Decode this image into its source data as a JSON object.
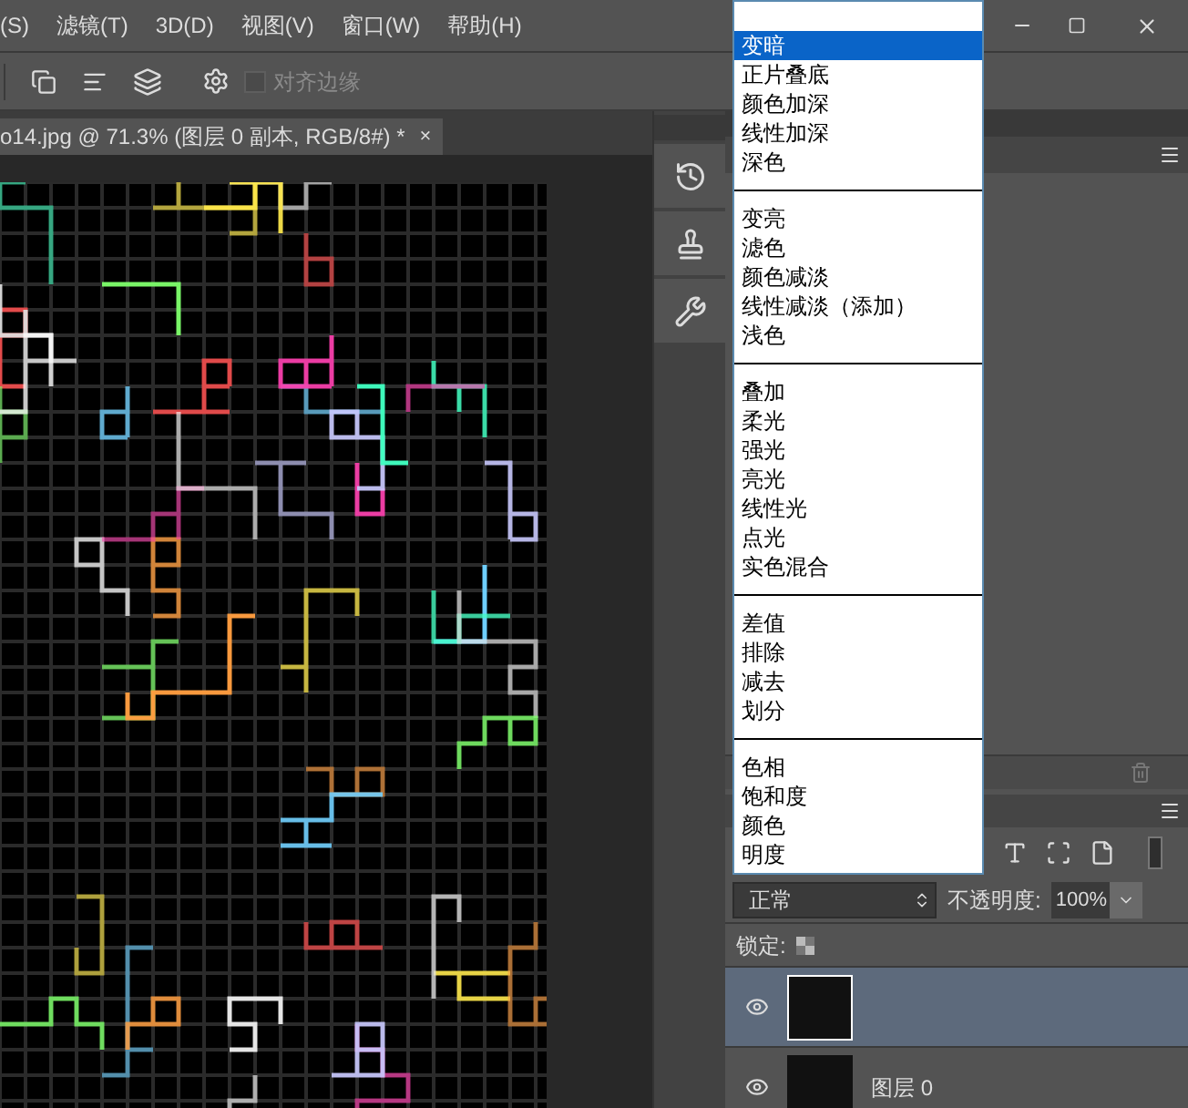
{
  "menu": [
    "(S)",
    "滤镜(T)",
    "3D(D)",
    "视图(V)",
    "窗口(W)",
    "帮助(H)"
  ],
  "options_bar": {
    "align_edges": {
      "label": "对齐边缘",
      "checked": false,
      "disabled": true
    }
  },
  "document_tab": {
    "title": "o14.jpg @ 71.3% (图层 0 副本, RGB/8#) *",
    "close": "×"
  },
  "blend_menu": {
    "groups": [
      [
        {
          "label": "变暗",
          "selected": true
        },
        {
          "label": "正片叠底",
          "selected": false
        },
        {
          "label": "颜色加深",
          "selected": false
        },
        {
          "label": "线性加深",
          "selected": false
        },
        {
          "label": "深色",
          "selected": false
        }
      ],
      [
        {
          "label": "变亮",
          "selected": false
        },
        {
          "label": "滤色",
          "selected": false
        },
        {
          "label": "颜色减淡",
          "selected": false
        },
        {
          "label": "线性减淡（添加）",
          "selected": false
        },
        {
          "label": "浅色",
          "selected": false
        }
      ],
      [
        {
          "label": "叠加",
          "selected": false
        },
        {
          "label": "柔光",
          "selected": false
        },
        {
          "label": "强光",
          "selected": false
        },
        {
          "label": "亮光",
          "selected": false
        },
        {
          "label": "线性光",
          "selected": false
        },
        {
          "label": "点光",
          "selected": false
        },
        {
          "label": "实色混合",
          "selected": false
        }
      ],
      [
        {
          "label": "差值",
          "selected": false
        },
        {
          "label": "排除",
          "selected": false
        },
        {
          "label": "减去",
          "selected": false
        },
        {
          "label": "划分",
          "selected": false
        }
      ],
      [
        {
          "label": "色相",
          "selected": false
        },
        {
          "label": "饱和度",
          "selected": false
        },
        {
          "label": "颜色",
          "selected": false
        },
        {
          "label": "明度",
          "selected": false
        }
      ]
    ]
  },
  "layers_panel": {
    "blend_mode": "正常",
    "opacity_label": "不透明度:",
    "opacity": "100%",
    "lock_label": "锁定:",
    "layers": [
      {
        "selected": true,
        "visible": true
      },
      {
        "name": "图层 0",
        "selected": false,
        "visible": true
      }
    ]
  }
}
